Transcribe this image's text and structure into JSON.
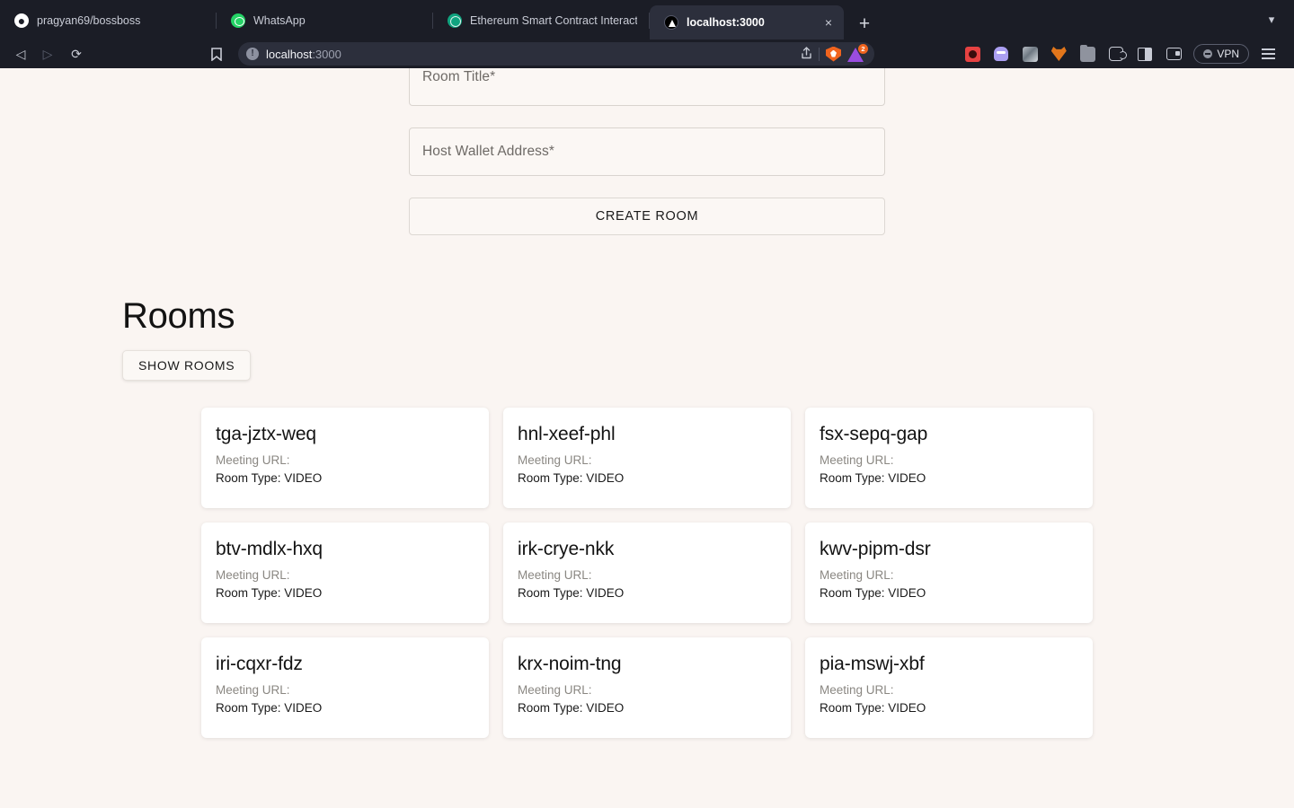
{
  "browser": {
    "tabs": [
      {
        "title": "pragyan69/bossboss",
        "favicon": "github-icon",
        "active": false
      },
      {
        "title": "WhatsApp",
        "favicon": "whatsapp-icon",
        "active": false
      },
      {
        "title": "Ethereum Smart Contract Interactio",
        "favicon": "chatgpt-icon",
        "active": false
      },
      {
        "title": "localhost:3000",
        "favicon": "nextjs-icon",
        "active": true
      }
    ],
    "new_tab_label": "+",
    "tab_close_label": "×",
    "tab_list_chevron": "▾",
    "nav": {
      "back": "◁",
      "forward": "▷",
      "reload": "⟳",
      "bookmark": "☐"
    },
    "url": {
      "host": "localhost",
      "port": ":3000",
      "info_icon_label": "!"
    },
    "url_actions": {
      "share": "⬆",
      "brave_shield": "brave-shield-icon",
      "leo_badge_count": "2"
    },
    "extensions": [
      {
        "name": "red-extension-icon"
      },
      {
        "name": "phantom-wallet-icon"
      },
      {
        "name": "screenshot-extension-icon"
      },
      {
        "name": "metamask-icon"
      },
      {
        "name": "gray-folder-extension-icon"
      },
      {
        "name": "puzzle-extensions-icon"
      },
      {
        "name": "sidebar-toggle-icon"
      },
      {
        "name": "wallet-icon"
      }
    ],
    "vpn_label": "VPN"
  },
  "page": {
    "form": {
      "room_title_label": "Room Title",
      "room_title_value": "",
      "host_wallet_label": "Host Wallet Address",
      "host_wallet_value": "",
      "required_mark": "*",
      "create_button": "CREATE ROOM"
    },
    "rooms": {
      "heading": "Rooms",
      "show_button": "SHOW ROOMS",
      "meeting_url_label": "Meeting URL:",
      "room_type_label": "Room Type: VIDEO",
      "cards": [
        {
          "id": "tga-jztx-weq",
          "meeting_url": "Meeting URL:",
          "room_type": "Room Type: VIDEO"
        },
        {
          "id": "hnl-xeef-phl",
          "meeting_url": "Meeting URL:",
          "room_type": "Room Type: VIDEO"
        },
        {
          "id": "fsx-sepq-gap",
          "meeting_url": "Meeting URL:",
          "room_type": "Room Type: VIDEO"
        },
        {
          "id": "btv-mdlx-hxq",
          "meeting_url": "Meeting URL:",
          "room_type": "Room Type: VIDEO"
        },
        {
          "id": "irk-crye-nkk",
          "meeting_url": "Meeting URL:",
          "room_type": "Room Type: VIDEO"
        },
        {
          "id": "kwv-pipm-dsr",
          "meeting_url": "Meeting URL:",
          "room_type": "Room Type: VIDEO"
        },
        {
          "id": "iri-cqxr-fdz",
          "meeting_url": "Meeting URL:",
          "room_type": "Room Type: VIDEO"
        },
        {
          "id": "krx-noim-tng",
          "meeting_url": "Meeting URL:",
          "room_type": "Room Type: VIDEO"
        },
        {
          "id": "pia-mswj-xbf",
          "meeting_url": "Meeting URL:",
          "room_type": "Room Type: VIDEO"
        }
      ]
    }
  },
  "colors": {
    "chrome_bg": "#1b1d26",
    "active_tab_bg": "#2c2f3c",
    "page_bg": "#faf5f2",
    "card_bg": "#ffffff",
    "brave_orange": "#f1641e",
    "whatsapp_green": "#25d366",
    "metamask_orange": "#e2761b"
  }
}
